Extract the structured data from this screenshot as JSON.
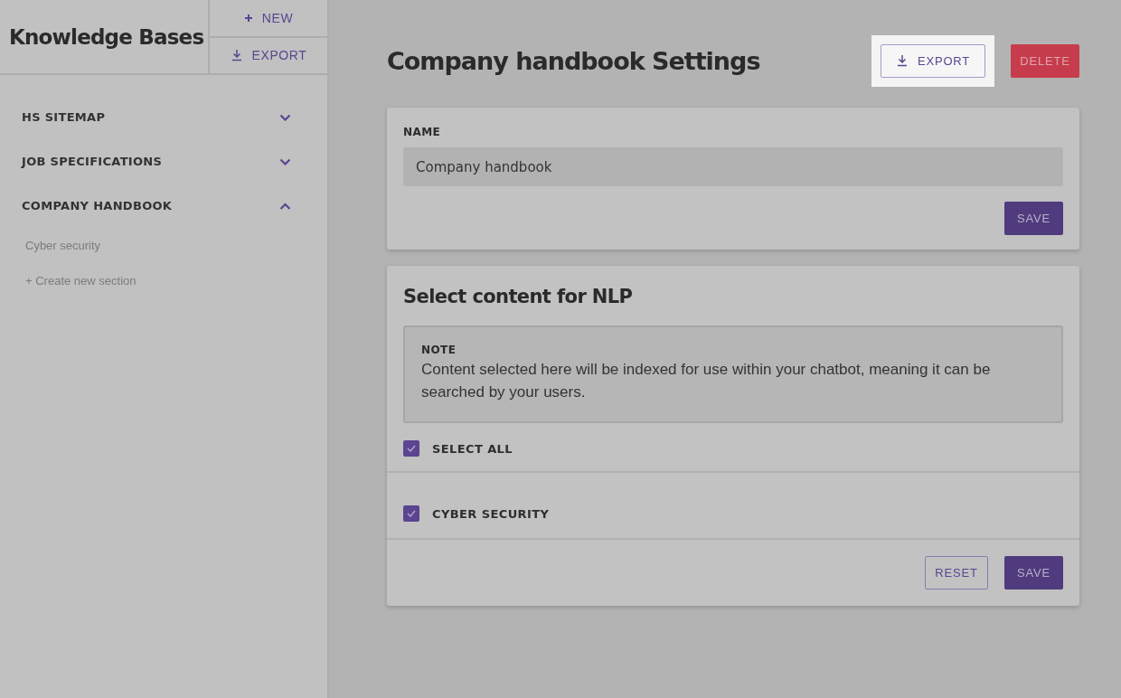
{
  "sidebar": {
    "title": "Knowledge Bases",
    "actions": [
      {
        "kind": "new",
        "label": "NEW"
      },
      {
        "kind": "export",
        "label": "EXPORT"
      }
    ],
    "items": [
      {
        "label": "HS SITEMAP",
        "expanded": false
      },
      {
        "label": "JOB SPECIFICATIONS",
        "expanded": false
      },
      {
        "label": "COMPANY HANDBOOK",
        "expanded": true,
        "children": [
          {
            "label": "Cyber security"
          }
        ],
        "create_label": "+ Create new section"
      }
    ]
  },
  "header": {
    "title": "Company handbook Settings",
    "actions": [
      {
        "kind": "outline",
        "label": "EXPORT",
        "spotlight": true
      },
      {
        "kind": "danger",
        "label": "DELETE",
        "spotlight": false
      }
    ]
  },
  "name_card": {
    "label": "NAME",
    "value": "Company handbook",
    "save": "SAVE"
  },
  "nlp_card": {
    "title": "Select content for NLP",
    "note_label": "NOTE",
    "note": "Content selected here will be indexed for use within your chatbot, meaning it can be searched by your users.",
    "select_all": {
      "label": "SELECT ALL",
      "checked": true
    },
    "items": [
      {
        "label": "CYBER SECURITY",
        "checked": true
      }
    ],
    "reset": "RESET",
    "save": "SAVE"
  }
}
